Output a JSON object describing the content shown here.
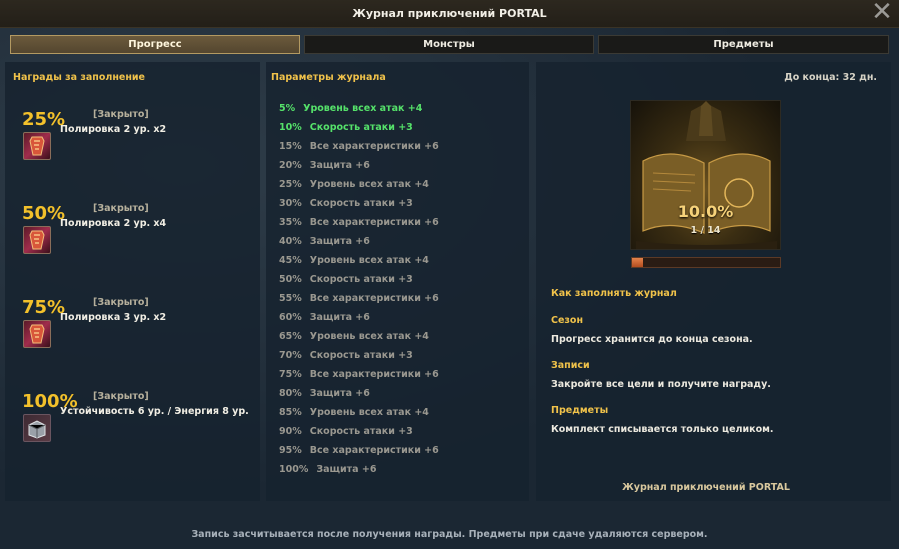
{
  "window": {
    "title": "Журнал приключений PORTAL",
    "close_symbol": "✕"
  },
  "tabs": [
    {
      "label": "Прогресс",
      "active": true
    },
    {
      "label": "Монстры",
      "active": false
    },
    {
      "label": "Предметы",
      "active": false
    }
  ],
  "left": {
    "heading": "Награды за заполнение",
    "rewards": [
      {
        "percent": "25%",
        "status": "[Закрыто]",
        "item": "Полировка 2 ур. x2",
        "icon": "polish-scroll-icon"
      },
      {
        "percent": "50%",
        "status": "[Закрыто]",
        "item": "Полировка 2 ур. x4",
        "icon": "polish-scroll-icon"
      },
      {
        "percent": "75%",
        "status": "[Закрыто]",
        "item": "Полировка 3 ур. x2",
        "icon": "polish-scroll-icon"
      },
      {
        "percent": "100%",
        "status": "[Закрыто]",
        "item": "Устойчивость 6 ур. / Энергия 8 ур.",
        "icon": "chest-icon"
      }
    ]
  },
  "middle": {
    "heading": "Параметры журнала",
    "params": [
      {
        "percent": "5%",
        "text": "Уровень всех атак +4",
        "done": true
      },
      {
        "percent": "10%",
        "text": "Скорость атаки +3",
        "done": true
      },
      {
        "percent": "15%",
        "text": "Все характеристики +6",
        "done": false
      },
      {
        "percent": "20%",
        "text": "Защита +6",
        "done": false
      },
      {
        "percent": "25%",
        "text": "Уровень всех атак +4",
        "done": false
      },
      {
        "percent": "30%",
        "text": "Скорость атаки +3",
        "done": false
      },
      {
        "percent": "35%",
        "text": "Все характеристики +6",
        "done": false
      },
      {
        "percent": "40%",
        "text": "Защита +6",
        "done": false
      },
      {
        "percent": "45%",
        "text": "Уровень всех атак +4",
        "done": false
      },
      {
        "percent": "50%",
        "text": "Скорость атаки +3",
        "done": false
      },
      {
        "percent": "55%",
        "text": "Все характеристики +6",
        "done": false
      },
      {
        "percent": "60%",
        "text": "Защита +6",
        "done": false
      },
      {
        "percent": "65%",
        "text": "Уровень всех атак +4",
        "done": false
      },
      {
        "percent": "70%",
        "text": "Скорость атаки +3",
        "done": false
      },
      {
        "percent": "75%",
        "text": "Все характеристики +6",
        "done": false
      },
      {
        "percent": "80%",
        "text": "Защита +6",
        "done": false
      },
      {
        "percent": "85%",
        "text": "Уровень всех атак +4",
        "done": false
      },
      {
        "percent": "90%",
        "text": "Скорость атаки +3",
        "done": false
      },
      {
        "percent": "95%",
        "text": "Все характеристики +6",
        "done": false
      },
      {
        "percent": "100%",
        "text": "Защита +6",
        "done": false
      }
    ]
  },
  "right": {
    "deadline": "До конца: 32 дн.",
    "progress_percent_label": "10.0%",
    "progress_count": "1 / 14",
    "progress_fraction": 0.071,
    "colors": {
      "bar_fill": "#d16a35",
      "accent": "#f0c24a",
      "done": "#55e26a"
    },
    "how_to_heading": "Как заполнять журнал",
    "sections": [
      {
        "heading": "Сезон",
        "text": "Прогресс хранится до конца сезона."
      },
      {
        "heading": "Записи",
        "text": "Закройте все цели и получите награду."
      },
      {
        "heading": "Предметы",
        "text": "Комплект списывается только целиком."
      }
    ],
    "footer_title": "Журнал приключений PORTAL"
  },
  "bottom_note": "Запись засчитывается после получения награды. Предметы при сдаче удаляются сервером."
}
